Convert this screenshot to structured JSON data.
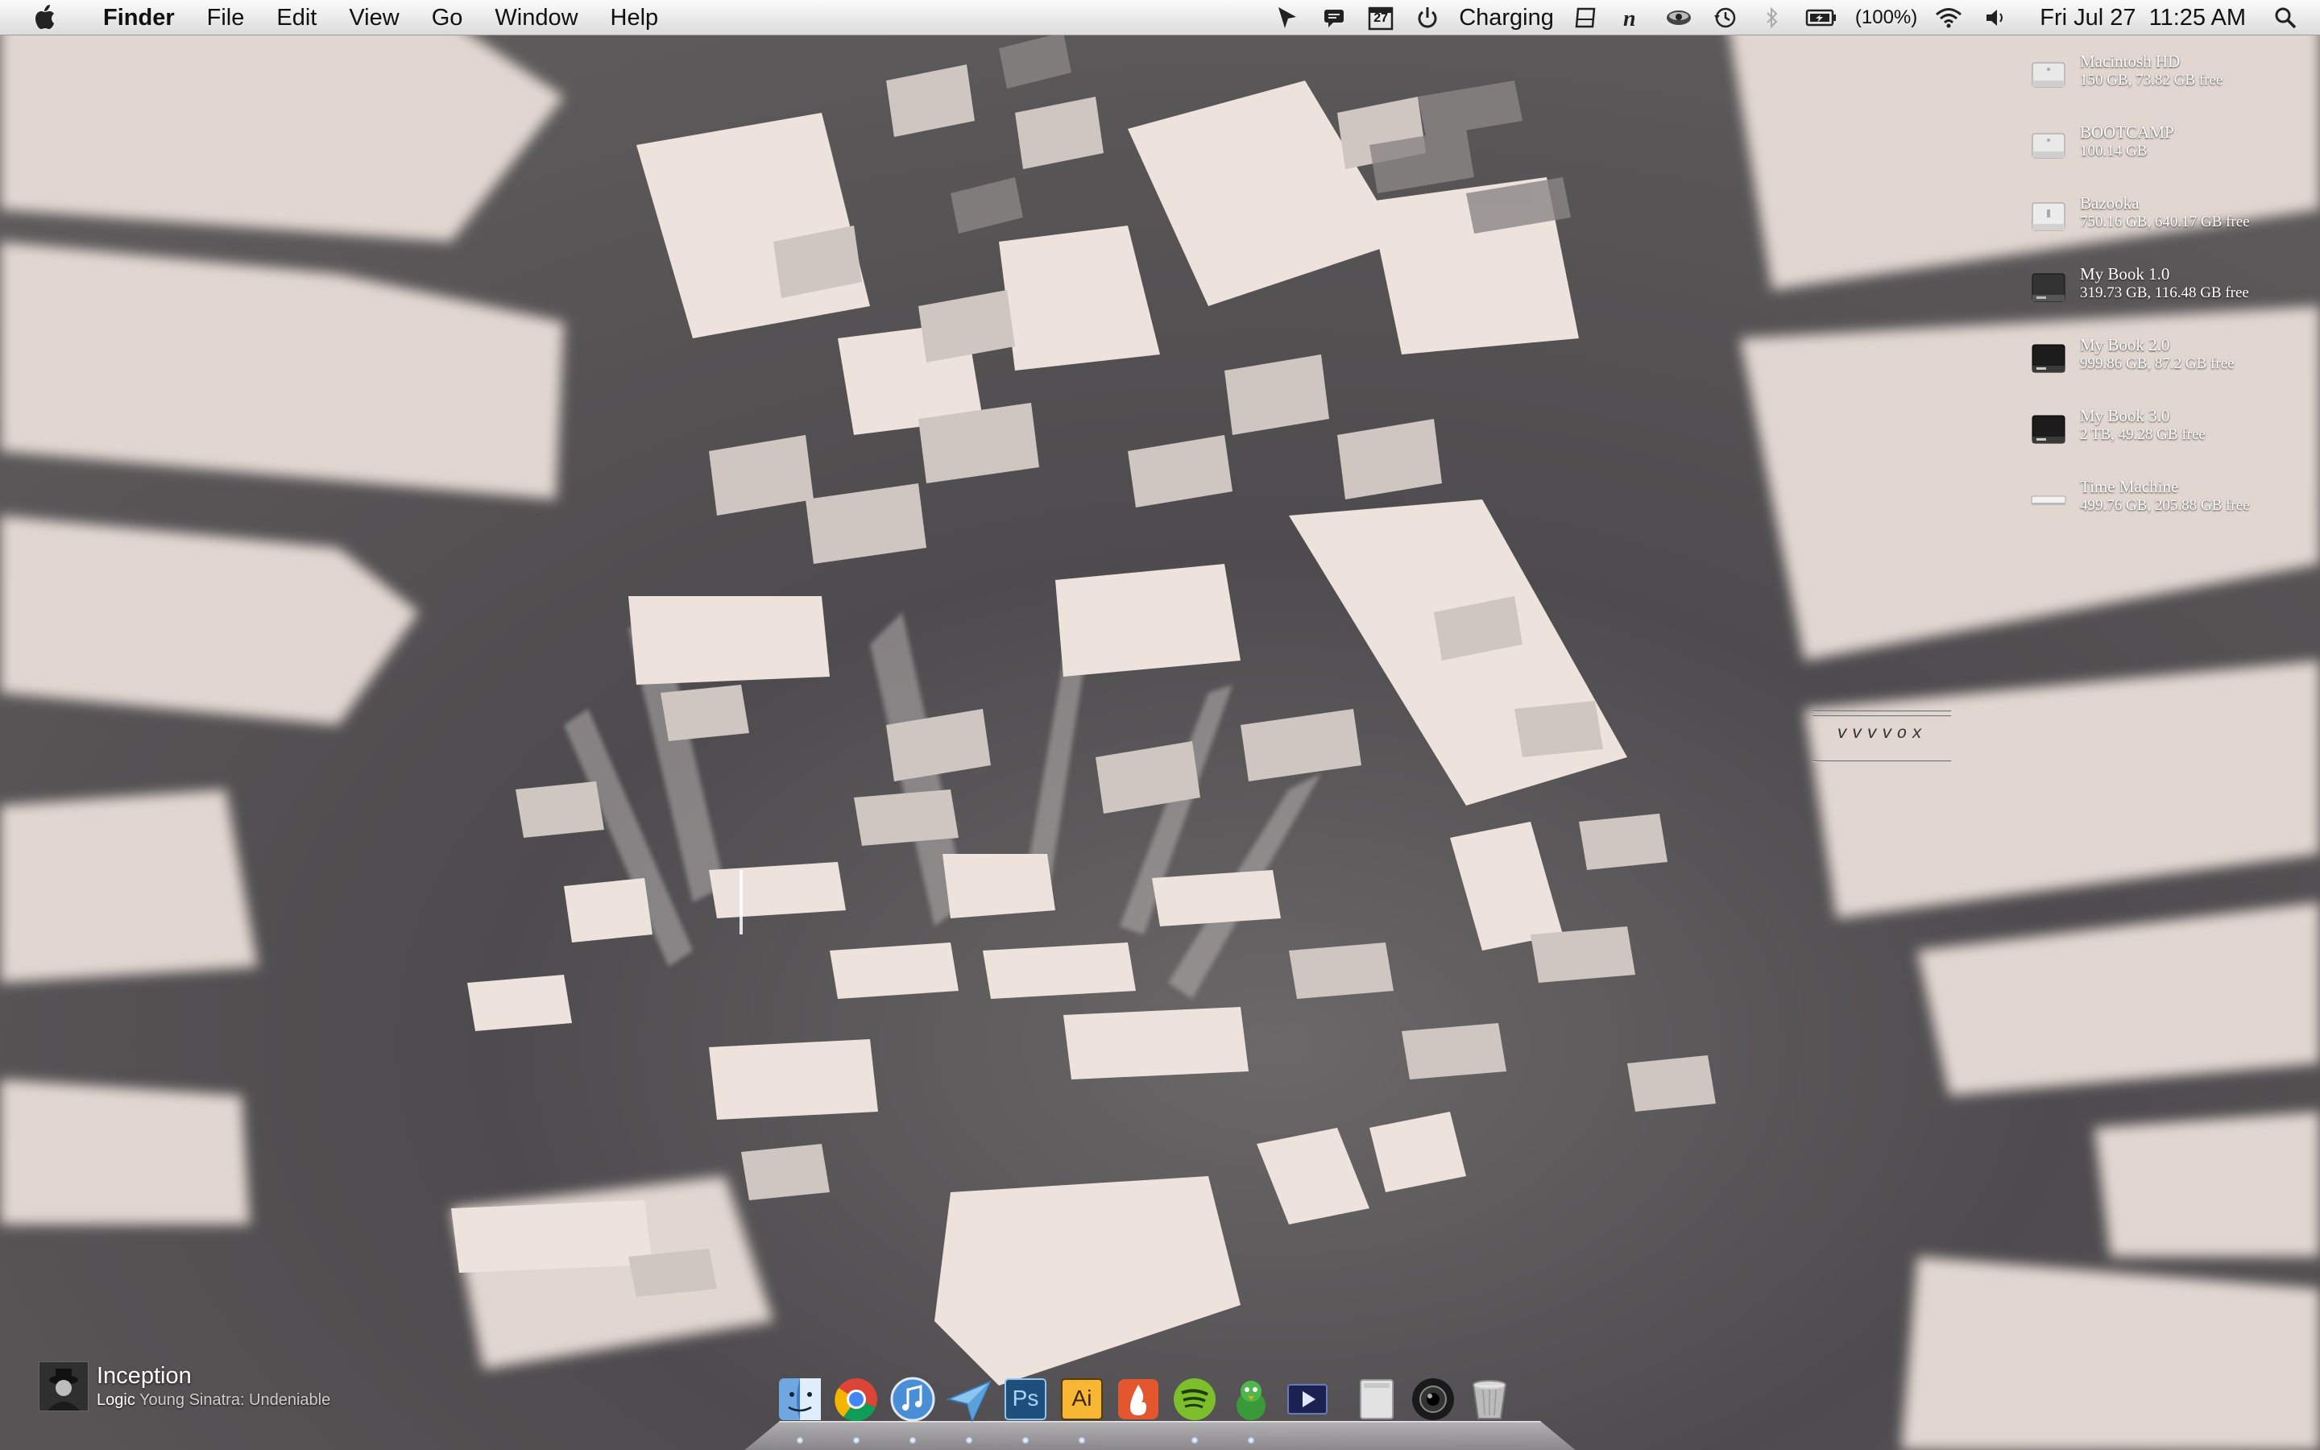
{
  "menubar": {
    "app_name": "Finder",
    "menus": [
      "File",
      "Edit",
      "View",
      "Go",
      "Window",
      "Help"
    ],
    "calendar_day": "27",
    "power_status": "Charging",
    "battery_percent": "(100%)",
    "datetime": "Fri Jul 27  11:25 AM",
    "status_icons": [
      "cursor-icon",
      "messages-icon",
      "calendar-icon",
      "power-icon",
      "notepad-icon",
      "n-app-icon",
      "eye-icon",
      "time-machine-icon",
      "bluetooth-icon",
      "battery-icon",
      "wifi-icon",
      "volume-icon",
      "spotlight-icon"
    ]
  },
  "drives": [
    {
      "name": "Macintosh HD",
      "size": "150 GB, 73.82 GB free"
    },
    {
      "name": "BOOTCAMP",
      "size": "100.14 GB"
    },
    {
      "name": "Bazooka",
      "size": "750.16 GB, 640.17 GB free"
    },
    {
      "name": "My Book 1.0",
      "size": "319.73 GB, 116.48 GB free"
    },
    {
      "name": "My Book 2.0",
      "size": "999.86 GB, 87.2 GB free"
    },
    {
      "name": "My Book 3.0",
      "size": "2 TB, 49.28 GB free"
    },
    {
      "name": "Time Machine",
      "size": "499.76 GB, 205.88 GB free"
    }
  ],
  "widget": {
    "text": "vvvvox"
  },
  "now_playing": {
    "title": "Inception",
    "artist": "Logic",
    "track": "Young Sinatra: Undeniable"
  },
  "dock": {
    "items": [
      "finder-icon",
      "chrome-icon",
      "itunes-icon",
      "mail-icon",
      "photoshop-icon",
      "illustrator-icon",
      "app-flame-icon",
      "spotify-icon",
      "adium-icon",
      "video-player-icon",
      "mac-pro-icon",
      "camera-icon",
      "trash-icon"
    ],
    "ps_label": "Ps",
    "ai_label": "Ai"
  }
}
